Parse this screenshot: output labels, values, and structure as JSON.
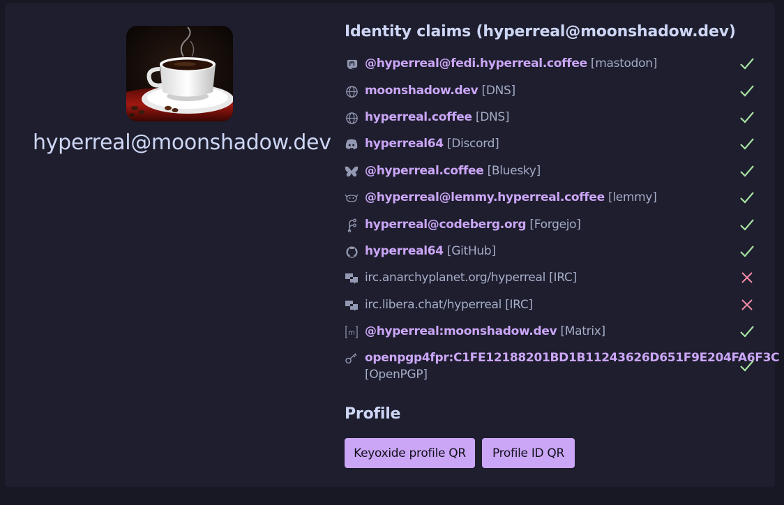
{
  "profile": {
    "name": "hyperreal@moonshadow.dev"
  },
  "claims_section": {
    "title": "Identity claims (hyperreal@moonshadow.dev)"
  },
  "claims": [
    {
      "icon": "mastodon-icon",
      "id": "@hyperreal@fedi.hyperreal.coffee",
      "type": "[mastodon]",
      "status": "verified"
    },
    {
      "icon": "globe-icon",
      "id": "moonshadow.dev",
      "type": "[DNS]",
      "status": "verified"
    },
    {
      "icon": "globe-icon",
      "id": "hyperreal.coffee",
      "type": "[DNS]",
      "status": "verified"
    },
    {
      "icon": "discord-icon",
      "id": "hyperreal64",
      "type": "[Discord]",
      "status": "verified"
    },
    {
      "icon": "butterfly-icon",
      "id": "@hyperreal.coffee",
      "type": "[Bluesky]",
      "status": "verified"
    },
    {
      "icon": "lemmy-icon",
      "id": "@hyperreal@lemmy.hyperreal.coffee",
      "type": "[lemmy]",
      "status": "verified"
    },
    {
      "icon": "forgejo-icon",
      "id": "hyperreal@codeberg.org",
      "type": "[Forgejo]",
      "status": "verified"
    },
    {
      "icon": "github-icon",
      "id": "hyperreal64",
      "type": "[GitHub]",
      "status": "verified"
    },
    {
      "icon": "chat-icon",
      "id": "irc.anarchyplanet.org/hyperreal",
      "type": "[IRC]",
      "status": "failed"
    },
    {
      "icon": "chat-icon",
      "id": "irc.libera.chat/hyperreal",
      "type": "[IRC]",
      "status": "failed"
    },
    {
      "icon": "matrix-icon",
      "id": "@hyperreal:moonshadow.dev",
      "type": "[Matrix]",
      "status": "verified"
    },
    {
      "icon": "key-icon",
      "id": "openpgp4fpr:C1FE12188201BD1B11243626D651F9E204FA6F3C",
      "type": "[OpenPGP]",
      "status": "verified"
    }
  ],
  "profile_section": {
    "title": "Profile",
    "buttons": {
      "keyoxide_qr": "Keyoxide profile QR",
      "profile_id_qr": "Profile ID QR"
    }
  },
  "colors": {
    "background": "#181825",
    "card": "#1e1e2e",
    "accent": "#cba6f7",
    "verified": "#a6e3a1",
    "failed": "#f38ba8"
  }
}
